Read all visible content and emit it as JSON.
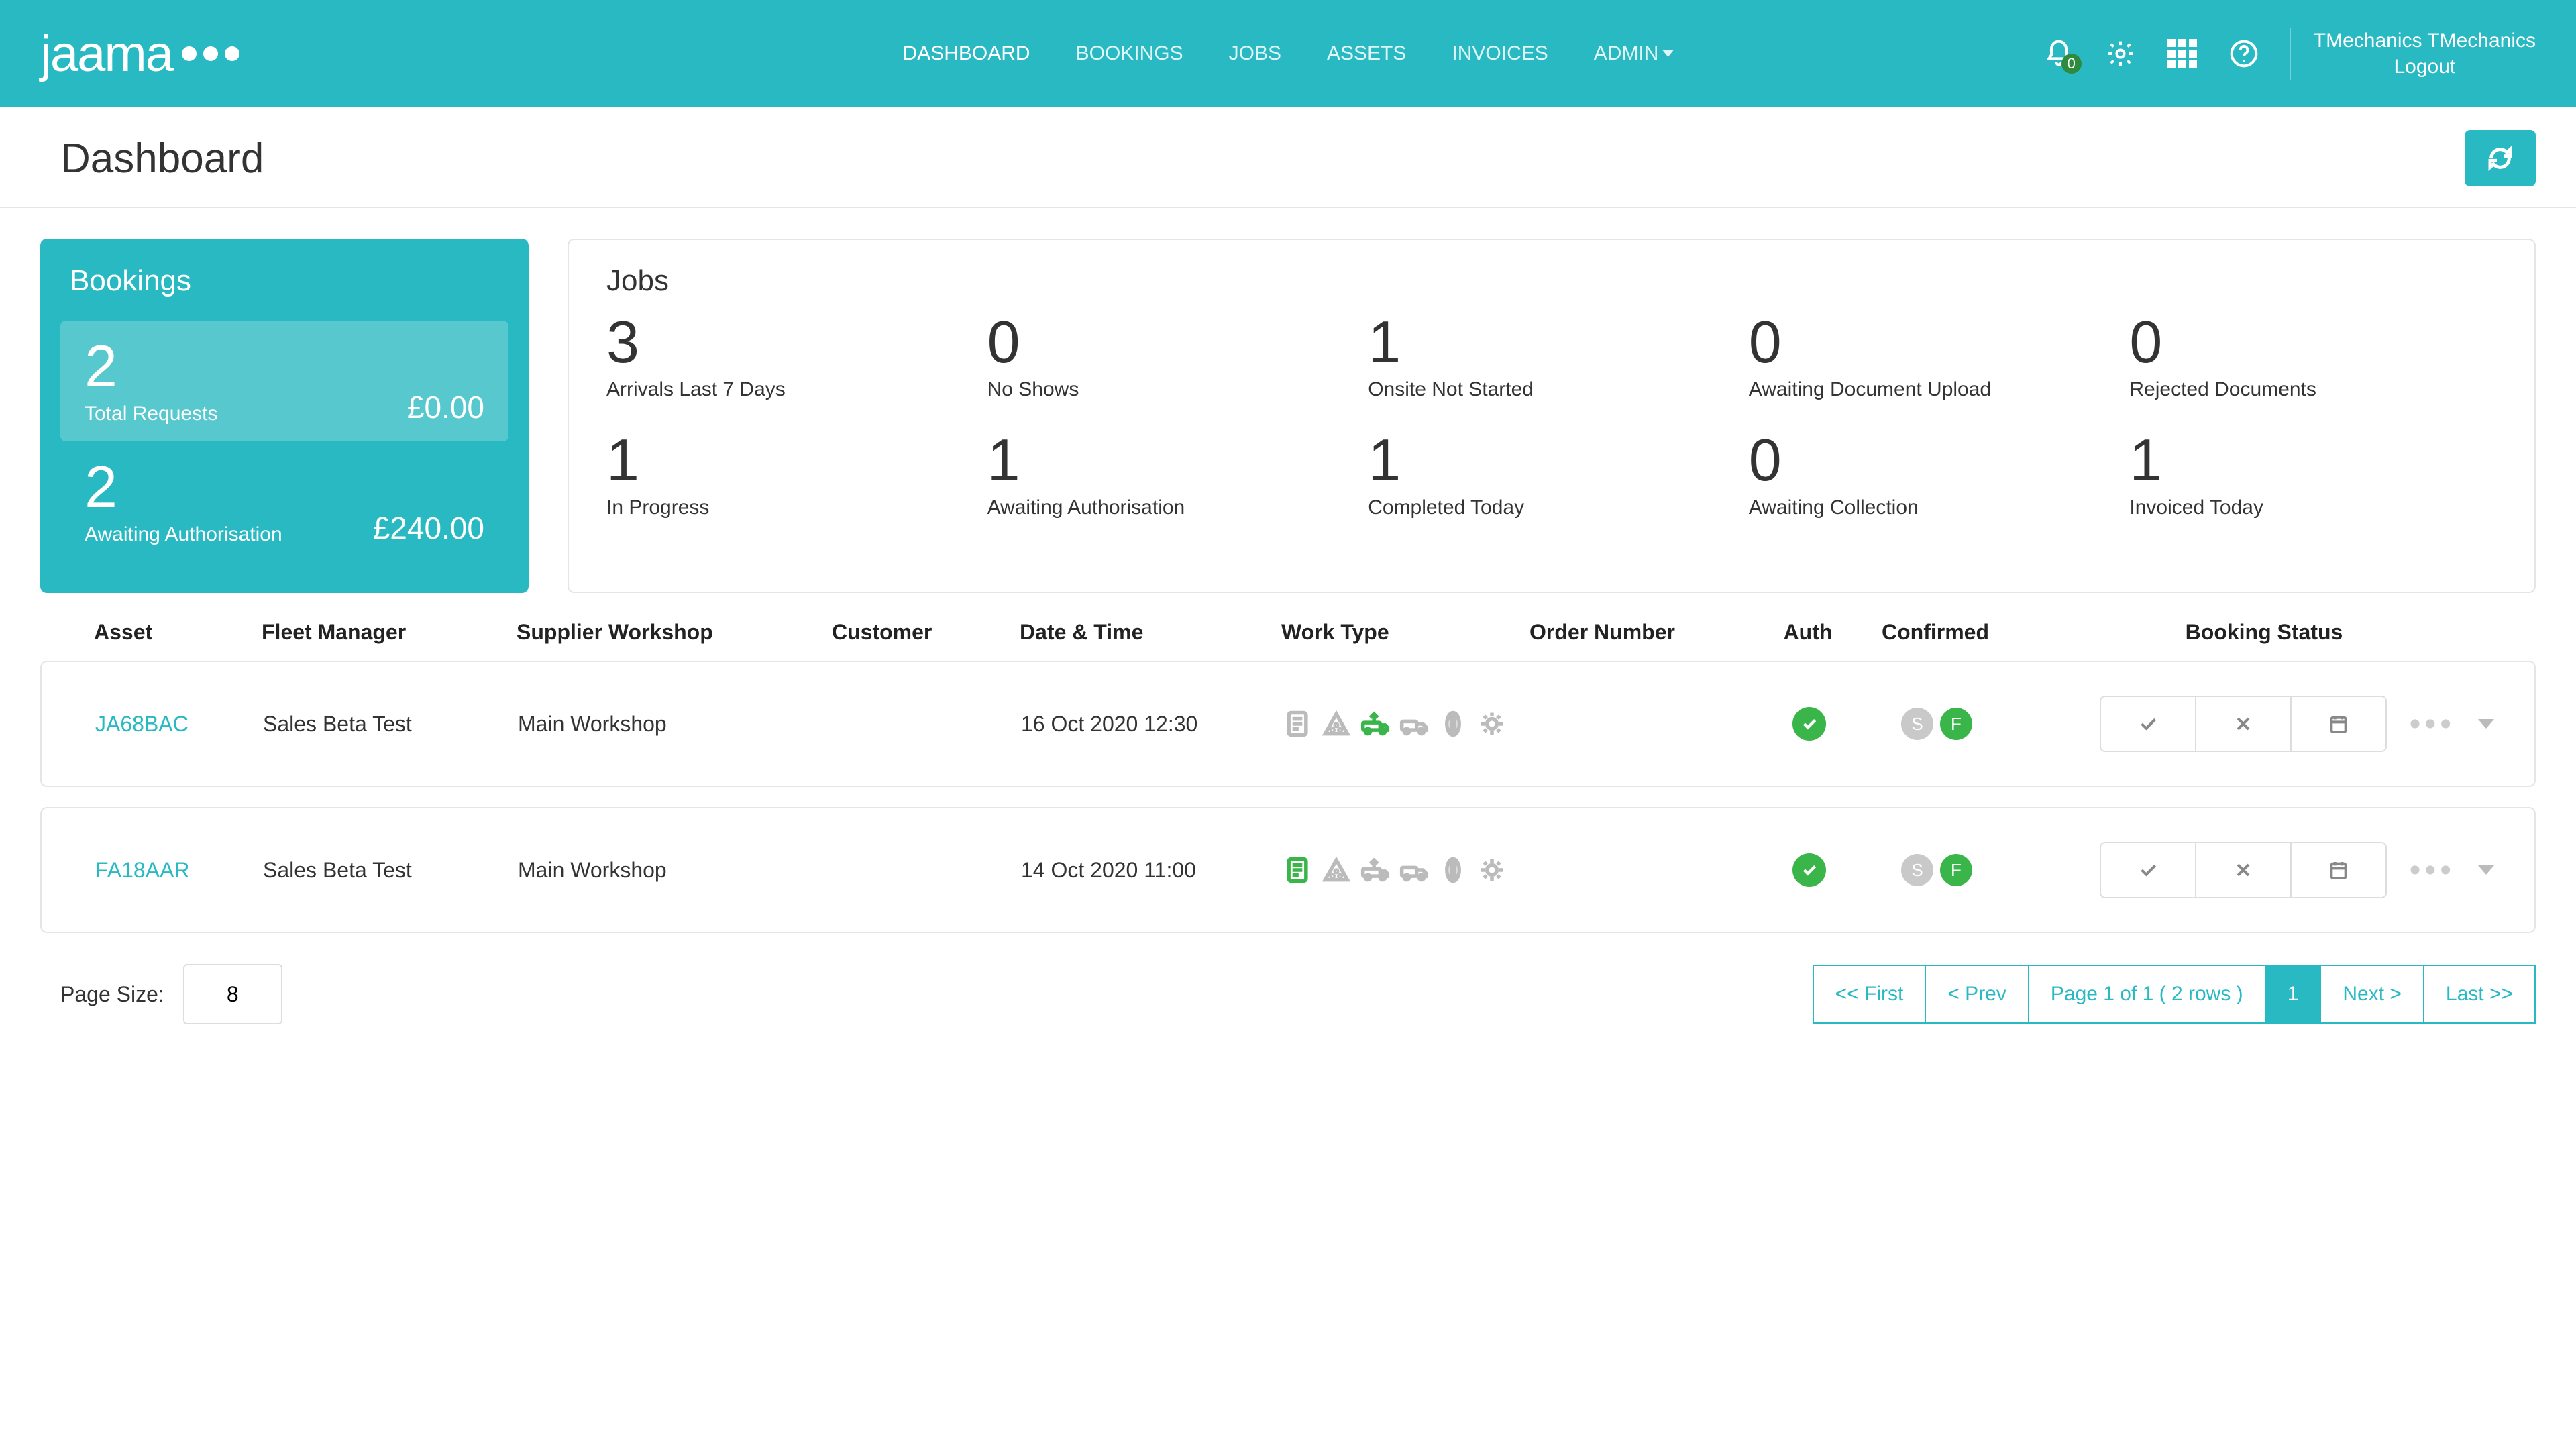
{
  "brand": "jaama",
  "nav": {
    "dashboard": "DASHBOARD",
    "bookings": "BOOKINGS",
    "jobs": "JOBS",
    "assets": "ASSETS",
    "invoices": "INVOICES",
    "admin": "ADMIN"
  },
  "notif_count": "0",
  "user_name": "TMechanics TMechanics",
  "logout": "Logout",
  "page_title": "Dashboard",
  "bookings_card": {
    "title": "Bookings",
    "total": {
      "count": "2",
      "label": "Total Requests",
      "amount": "£0.00"
    },
    "await": {
      "count": "2",
      "label": "Awaiting Authorisation",
      "amount": "£240.00"
    }
  },
  "jobs_card": {
    "title": "Jobs",
    "stats": [
      {
        "count": "3",
        "label": "Arrivals Last 7 Days"
      },
      {
        "count": "0",
        "label": "No Shows"
      },
      {
        "count": "1",
        "label": "Onsite Not Started"
      },
      {
        "count": "0",
        "label": "Awaiting Document Upload"
      },
      {
        "count": "0",
        "label": "Rejected Documents"
      },
      {
        "count": "1",
        "label": "In Progress"
      },
      {
        "count": "1",
        "label": "Awaiting Authorisation"
      },
      {
        "count": "1",
        "label": "Completed Today"
      },
      {
        "count": "0",
        "label": "Awaiting Collection"
      },
      {
        "count": "1",
        "label": "Invoiced Today"
      }
    ]
  },
  "columns": {
    "asset": "Asset",
    "fm": "Fleet Manager",
    "sw": "Supplier Workshop",
    "cust": "Customer",
    "dt": "Date & Time",
    "wt": "Work Type",
    "on": "Order Number",
    "auth": "Auth",
    "conf": "Confirmed",
    "bstat": "Booking Status"
  },
  "rows": [
    {
      "asset": "JA68BAC",
      "fm": "Sales Beta Test",
      "sw": "Main Workshop",
      "cust": "",
      "dt": "16 Oct 2020 12:30",
      "wt_active": 2,
      "s": "S",
      "f": "F"
    },
    {
      "asset": "FA18AAR",
      "fm": "Sales Beta Test",
      "sw": "Main Workshop",
      "cust": "",
      "dt": "14 Oct 2020 11:00",
      "wt_active": 0,
      "s": "S",
      "f": "F"
    }
  ],
  "page_size_label": "Page Size:",
  "page_size_value": "8",
  "pager": {
    "first": "<< First",
    "prev": "< Prev",
    "info": "Page 1 of 1 ( 2 rows )",
    "p1": "1",
    "next": "Next >",
    "last": "Last >>"
  }
}
